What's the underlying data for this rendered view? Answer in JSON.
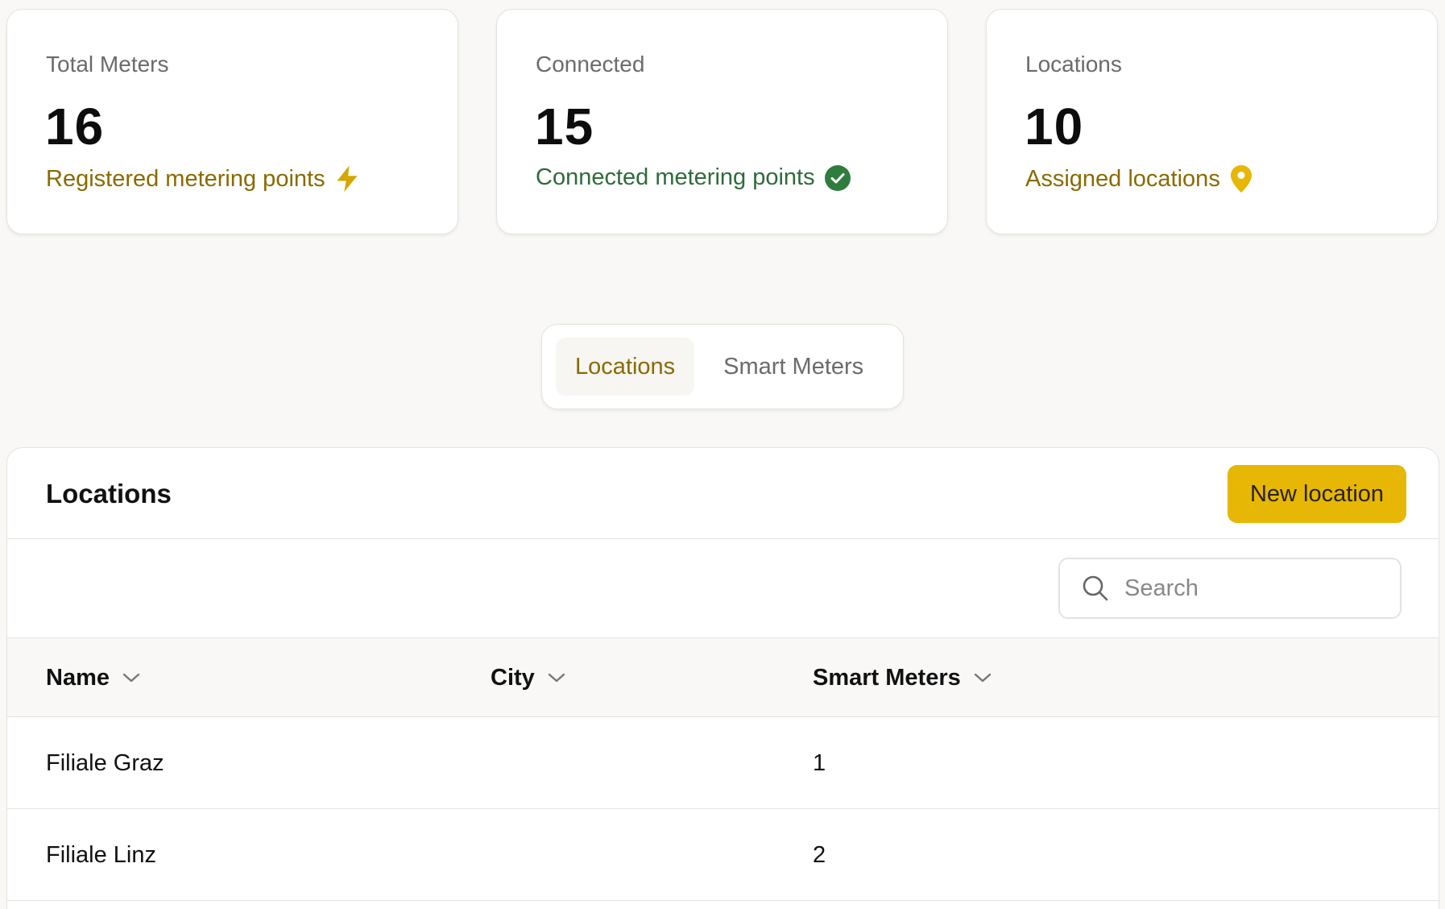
{
  "stats": [
    {
      "title": "Total Meters",
      "value": "16",
      "subtitle": "Registered metering points",
      "icon": "lightning-icon"
    },
    {
      "title": "Connected",
      "value": "15",
      "subtitle": "Connected metering points",
      "icon": "check-circle-icon"
    },
    {
      "title": "Locations",
      "value": "10",
      "subtitle": "Assigned locations",
      "icon": "map-pin-icon"
    }
  ],
  "tabs": [
    {
      "label": "Locations",
      "active": true
    },
    {
      "label": "Smart Meters",
      "active": false
    }
  ],
  "panel": {
    "title": "Locations",
    "new_button": "New location",
    "search_placeholder": "Search"
  },
  "table": {
    "columns": [
      "Name",
      "City",
      "Smart Meters"
    ],
    "rows": [
      {
        "name": "Filiale Graz",
        "city": "",
        "smart_meters": "1"
      },
      {
        "name": "Filiale Linz",
        "city": "",
        "smart_meters": "2"
      }
    ]
  },
  "colors": {
    "accent": "#e6b705",
    "accent_text": "#8a6a00",
    "success": "#2f6b3a",
    "background": "#f9f8f6"
  }
}
